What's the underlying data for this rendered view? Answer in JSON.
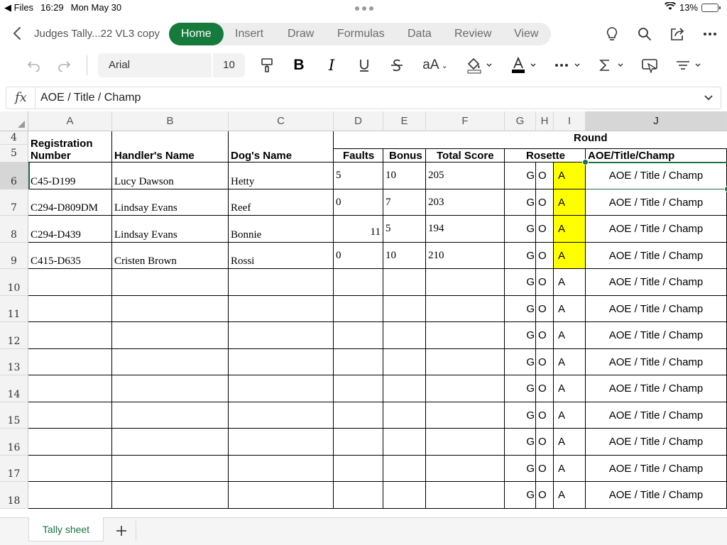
{
  "status_bar": {
    "back_app": "◀ Files",
    "time": "16:29",
    "date": "Mon May 30",
    "battery": "13%",
    "battery_level": 0.13
  },
  "app": {
    "doc_title": "Judges Tally...22 VL3 copy",
    "tabs": [
      "Home",
      "Insert",
      "Draw",
      "Formulas",
      "Data",
      "Review",
      "View"
    ],
    "active_tab": "Home",
    "accent_color": "#177a3d"
  },
  "toolbar": {
    "font_name": "Arial",
    "font_size": "10"
  },
  "formula_bar": {
    "fx_label": "fx",
    "value": "AOE / Title / Champ"
  },
  "sheet": {
    "columns": [
      "A",
      "B",
      "C",
      "D",
      "E",
      "F",
      "G",
      "H",
      "I",
      "J"
    ],
    "selected_column": "J",
    "rows": [
      "4",
      "5",
      "6",
      "7",
      "8",
      "9",
      "10",
      "11",
      "12",
      "13",
      "14",
      "15",
      "16",
      "17",
      "18"
    ],
    "selected_row": "6",
    "headers": {
      "registration": "Registration\nNumber",
      "handler": "Handler's Name",
      "dog": "Dog's Name",
      "round": "Round",
      "faults": "Faults",
      "bonus": "Bonus",
      "total": "Total Score",
      "rosette": "Rosette",
      "aoe": "AOE/Title/Champ"
    },
    "entries": [
      {
        "reg": "C45-D199",
        "handler": "Lucy Dawson",
        "dog": "Hetty",
        "faults": "5",
        "bonus": "10",
        "total": "205"
      },
      {
        "reg": "C294-D809DM",
        "handler": "Lindsay Evans",
        "dog": "Reef",
        "faults": "0",
        "bonus": "7",
        "total": "203"
      },
      {
        "reg": "C294-D439",
        "handler": "Lindsay Evans",
        "dog": "Bonnie",
        "faults": "11",
        "bonus": "5",
        "total": "194"
      },
      {
        "reg": "C415-D635",
        "handler": "Cristen Brown",
        "dog": "Rossi",
        "faults": "0",
        "bonus": "10",
        "total": "210"
      }
    ],
    "rosette_g": "G",
    "rosette_o": "O",
    "rosette_a": "A",
    "aoe_value": "AOE / Title / Champ",
    "highlight_color": "#ffff00"
  },
  "sheet_tabs": {
    "active": "Tally sheet",
    "add_label": "+"
  }
}
